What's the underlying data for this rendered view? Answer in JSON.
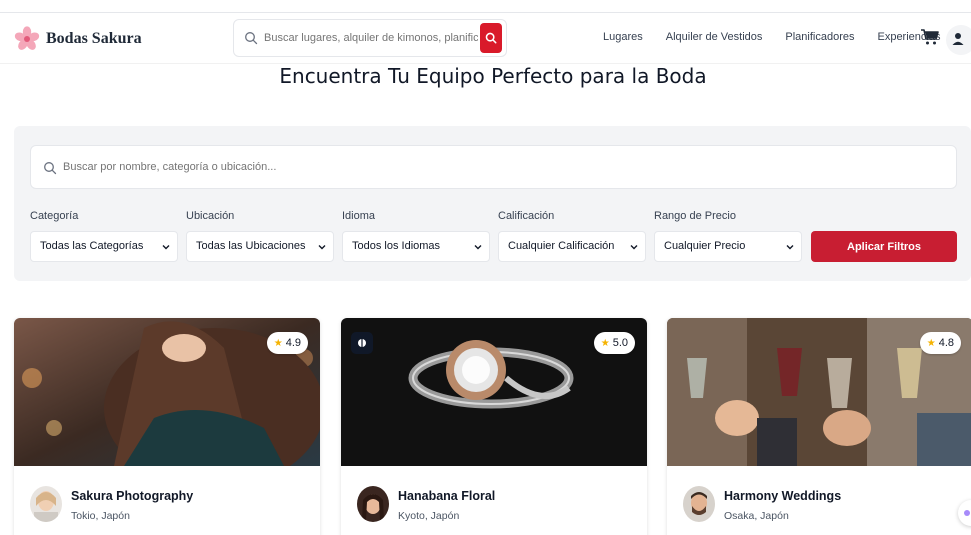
{
  "header": {
    "brand": "Bodas Sakura",
    "search_placeholder": "Buscar lugares, alquiler de kimonos, planificadores...",
    "nav": [
      "Lugares",
      "Alquiler de Vestidos",
      "Planificadores",
      "Experiencias"
    ]
  },
  "page": {
    "title": "Encuentra Tu Equipo Perfecto para la Boda"
  },
  "filters": {
    "search_placeholder": "Buscar por nombre, categoría o ubicación...",
    "category": {
      "label": "Categoría",
      "value": "Todas las Categorías"
    },
    "location": {
      "label": "Ubicación",
      "value": "Todas las Ubicaciones"
    },
    "language": {
      "label": "Idioma",
      "value": "Todos los Idiomas"
    },
    "rating": {
      "label": "Calificación",
      "value": "Cualquier Calificación"
    },
    "price": {
      "label": "Rango de Precio",
      "value": "Cualquier Precio"
    },
    "apply_label": "Aplicar Filtros"
  },
  "vendors": [
    {
      "name": "Sakura Photography",
      "location": "Tokio, Japón",
      "rating": "4.9"
    },
    {
      "name": "Hanabana Floral",
      "location": "Kyoto, Japón",
      "rating": "5.0"
    },
    {
      "name": "Harmony Weddings",
      "location": "Osaka, Japón",
      "rating": "4.8"
    }
  ],
  "colors": {
    "accent": "#c81e32",
    "panel": "#f3f4f6",
    "star": "#f5b301"
  }
}
